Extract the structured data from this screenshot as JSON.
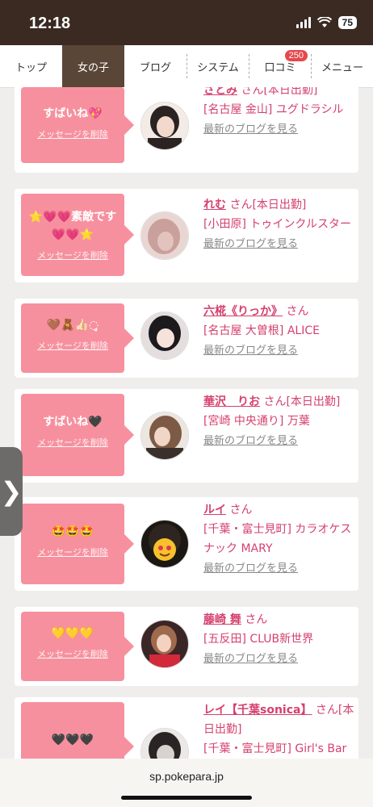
{
  "status": {
    "time": "12:18",
    "battery": "75"
  },
  "nav": {
    "tabs": [
      {
        "label": "トップ"
      },
      {
        "label": "女の子"
      },
      {
        "label": "ブログ"
      },
      {
        "label": "システム"
      },
      {
        "label": "口コミ",
        "badge": "250"
      },
      {
        "label": "メニュー"
      }
    ]
  },
  "cards": [
    {
      "message": "すばいね💖",
      "delete": "メッセージを削除",
      "name": "さとみ",
      "san": "さん[本日出勤]",
      "shop": "[名古屋 金山] ユグドラシル",
      "blog": "最新のブログを見る"
    },
    {
      "message": "⭐💗💗素敵です💗💗⭐",
      "delete": "メッセージを削除",
      "name": "れむ",
      "san": "さん[本日出勤]",
      "shop": "[小田原] トゥインクルスター",
      "blog": "最新のブログを見る"
    },
    {
      "message": "🤎🧸👍🏻◌̥",
      "delete": "メッセージを削除",
      "name": "六椛《りっか》",
      "san": "さん",
      "shop": "[名古屋 大曽根] ALICE",
      "blog": "最新のブログを見る"
    },
    {
      "message": "すばいね🖤",
      "delete": "メッセージを削除",
      "name": "華沢　りお",
      "san": "さん[本日出勤]",
      "shop": "[宮崎 中央通り] 万葉",
      "blog": "最新のブログを見る"
    },
    {
      "message": "🤩🤩🤩",
      "delete": "メッセージを削除",
      "name": "ルイ",
      "san": "さん",
      "shop": "[千葉・富士見町] カラオケスナック MARY",
      "blog": "最新のブログを見る"
    },
    {
      "message": "💛💛💛",
      "delete": "メッセージを削除",
      "name": "藤崎 舞",
      "san": "さん",
      "shop": "[五反田] CLUB新世界",
      "blog": "最新のブログを見る"
    },
    {
      "message": "🖤🖤🖤",
      "delete": "",
      "name": "レイ【千葉sonica】",
      "san": "さん[本日出勤]",
      "shop": "[千葉・富士見町] Girl's Bar",
      "blog": ""
    }
  ],
  "browser": {
    "url": "sp.pokepara.jp"
  },
  "colors": {
    "header_bg": "#3a2a22",
    "active_tab": "#5a4637",
    "accent_pink": "#d5406e",
    "message_bg": "#f7909e",
    "badge": "#e5484d"
  },
  "icons": {
    "side_handle": "chevron-right-icon"
  }
}
